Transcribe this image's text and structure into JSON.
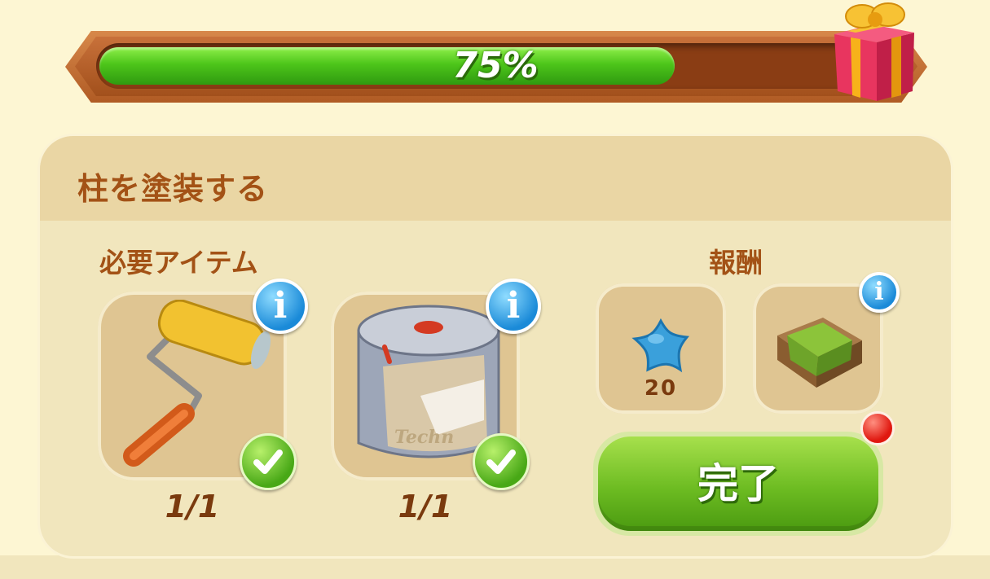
{
  "progress": {
    "label": "75%",
    "fraction": 0.75
  },
  "task": {
    "title": "柱を塗装する",
    "required_label": "必要アイテム",
    "reward_label": "報酬",
    "required_items": [
      {
        "name": "paint-roller",
        "count": "1/1"
      },
      {
        "name": "paint-can",
        "count": "1/1",
        "can_text": "Techn"
      }
    ],
    "rewards": [
      {
        "name": "blue-star",
        "amount": "20"
      },
      {
        "name": "green-crate"
      }
    ],
    "complete_label": "完了"
  },
  "colors": {
    "title_brown": "#a35216",
    "progress_green": "#4dc51a",
    "info_blue": "#1a8ad8",
    "button_green": "#6dbc22",
    "notify_red": "#e01810"
  }
}
